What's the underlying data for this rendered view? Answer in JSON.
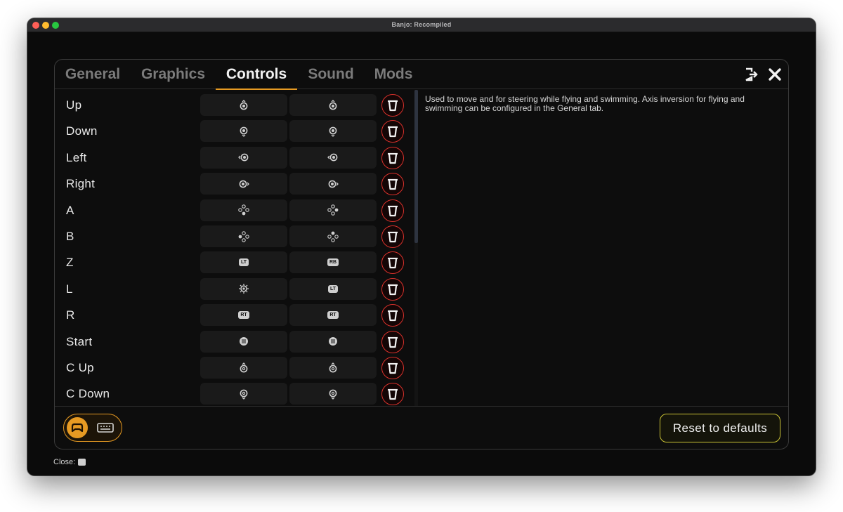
{
  "window": {
    "title": "Banjo: Recompiled"
  },
  "tabs": [
    {
      "label": "General",
      "active": false
    },
    {
      "label": "Graphics",
      "active": false
    },
    {
      "label": "Controls",
      "active": true
    },
    {
      "label": "Sound",
      "active": false
    },
    {
      "label": "Mods",
      "active": false
    }
  ],
  "header_icons": {
    "exit": "exit-icon",
    "close": "close-icon"
  },
  "bindings": [
    {
      "label": "Up",
      "primary": "left-stick-up",
      "secondary": "left-stick-up"
    },
    {
      "label": "Down",
      "primary": "left-stick-down",
      "secondary": "left-stick-down"
    },
    {
      "label": "Left",
      "primary": "left-stick-left",
      "secondary": "left-stick-left"
    },
    {
      "label": "Right",
      "primary": "left-stick-right",
      "secondary": "left-stick-right"
    },
    {
      "label": "A",
      "primary": "face-button-bottom",
      "secondary": "face-button-right"
    },
    {
      "label": "B",
      "primary": "face-button-left",
      "secondary": "face-button-top"
    },
    {
      "label": "Z",
      "primary": "LT",
      "secondary": "RB"
    },
    {
      "label": "L",
      "primary": "dpad-icon",
      "secondary": "LT"
    },
    {
      "label": "R",
      "primary": "RT",
      "secondary": "RT"
    },
    {
      "label": "Start",
      "primary": "menu-button",
      "secondary": "menu-button"
    },
    {
      "label": "C Up",
      "primary": "right-stick-up",
      "secondary": "right-stick-up"
    },
    {
      "label": "C Down",
      "primary": "right-stick-down",
      "secondary": "right-stick-down"
    }
  ],
  "description": "Used to move and for steering while flying and swimming. Axis inversion for flying and swimming can be configured in the General tab.",
  "footer": {
    "reset_label": "Reset to defaults",
    "close_label": "Close:",
    "input_modes": [
      "controller",
      "keyboard"
    ]
  },
  "colors": {
    "accent": "#e69a23",
    "delete": "#d8312b",
    "reset_border": "#c9c235"
  }
}
